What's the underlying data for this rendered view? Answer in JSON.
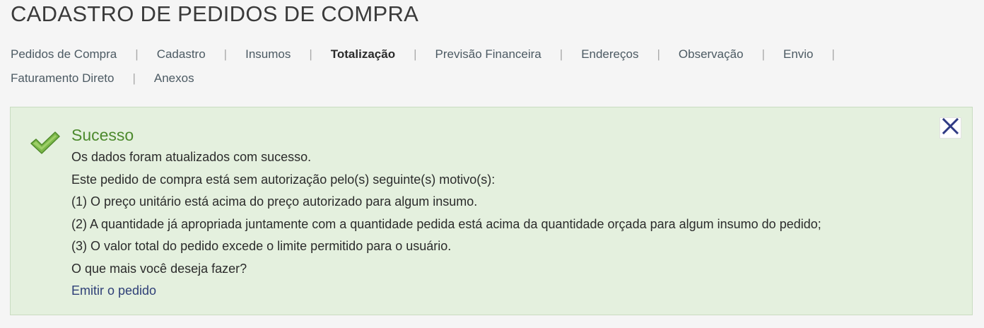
{
  "header": {
    "title": "CADASTRO DE PEDIDOS DE COMPRA"
  },
  "tabs": [
    {
      "label": "Pedidos de Compra",
      "active": false
    },
    {
      "label": "Cadastro",
      "active": false
    },
    {
      "label": "Insumos",
      "active": false
    },
    {
      "label": "Totalização",
      "active": true
    },
    {
      "label": "Previsão Financeira",
      "active": false
    },
    {
      "label": "Endereços",
      "active": false
    },
    {
      "label": "Observação",
      "active": false
    },
    {
      "label": "Envio",
      "active": false
    },
    {
      "label": "Faturamento Direto",
      "active": false
    },
    {
      "label": "Anexos",
      "active": false
    }
  ],
  "separator": "|",
  "alert": {
    "title": "Sucesso",
    "lines": [
      "Os dados foram atualizados com sucesso.",
      "Este pedido de compra está sem autorização pelo(s) seguinte(s) motivo(s):",
      "(1) O preço unitário está acima do preço autorizado para algum insumo.",
      "(2) A quantidade já apropriada juntamente com a quantidade pedida está acima da quantidade orçada para algum insumo do pedido;",
      "(3) O valor total do pedido excede o limite permitido para o usuário.",
      "O que mais você deseja fazer?"
    ],
    "link_label": "Emitir o pedido",
    "status_icon": "check-icon",
    "close_icon": "close-icon"
  },
  "colors": {
    "success_title": "#4d8a2e",
    "alert_background": "#e4f0de",
    "link": "#2e3f77",
    "close_icon": "#2f3a84",
    "check_icon": "#7cb84a"
  }
}
